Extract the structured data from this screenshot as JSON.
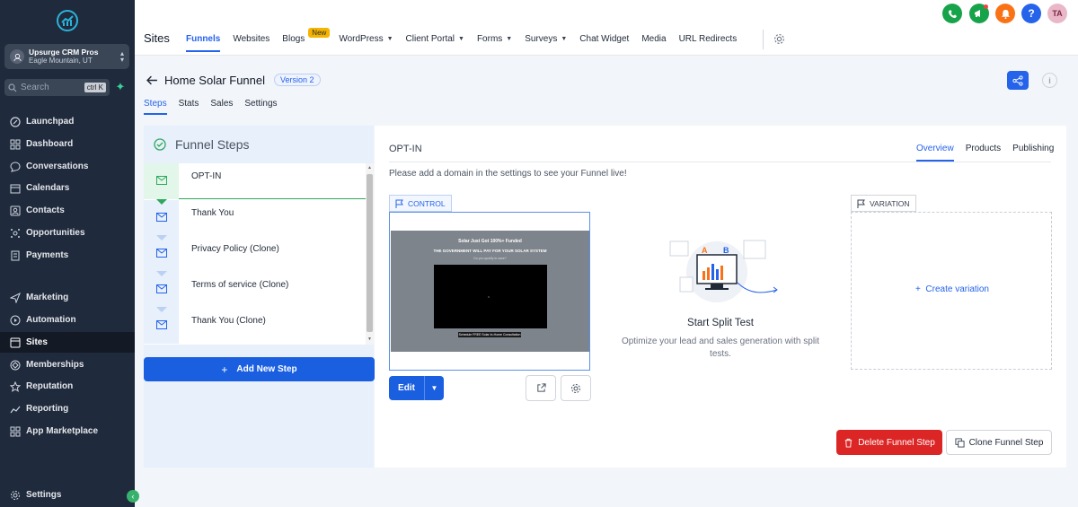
{
  "sidebar": {
    "account": {
      "name": "Upsurge CRM Pros",
      "location": "Eagle Mountain, UT"
    },
    "search": {
      "placeholder": "Search",
      "shortcut": "ctrl K"
    },
    "items": [
      {
        "label": "Launchpad",
        "icon": "rocket-icon"
      },
      {
        "label": "Dashboard",
        "icon": "dashboard-icon"
      },
      {
        "label": "Conversations",
        "icon": "chat-icon"
      },
      {
        "label": "Calendars",
        "icon": "calendar-icon"
      },
      {
        "label": "Contacts",
        "icon": "contacts-icon"
      },
      {
        "label": "Opportunities",
        "icon": "opportunities-icon"
      },
      {
        "label": "Payments",
        "icon": "payments-icon"
      },
      {
        "label": "Marketing",
        "icon": "send-icon"
      },
      {
        "label": "Automation",
        "icon": "automation-icon"
      },
      {
        "label": "Sites",
        "icon": "sites-icon"
      },
      {
        "label": "Memberships",
        "icon": "memberships-icon"
      },
      {
        "label": "Reputation",
        "icon": "star-icon"
      },
      {
        "label": "Reporting",
        "icon": "reporting-icon"
      },
      {
        "label": "App Marketplace",
        "icon": "apps-icon"
      }
    ],
    "active": "Sites",
    "settings_label": "Settings"
  },
  "topbar": {
    "title": "Sites",
    "tabs": [
      {
        "label": "Funnels",
        "active": true
      },
      {
        "label": "Websites"
      },
      {
        "label": "Blogs",
        "badge": "New"
      },
      {
        "label": "WordPress",
        "dropdown": true
      },
      {
        "label": "Client Portal",
        "dropdown": true
      },
      {
        "label": "Forms",
        "dropdown": true
      },
      {
        "label": "Surveys",
        "dropdown": true
      },
      {
        "label": "Chat Widget"
      },
      {
        "label": "Media"
      },
      {
        "label": "URL Redirects"
      }
    ],
    "avatar_initials": "TA",
    "colors": {
      "phone": "#16a34a",
      "announce": "#16a34a",
      "bell": "#f97316",
      "help": "#2563eb"
    }
  },
  "page": {
    "title": "Home Solar Funnel",
    "version": "Version 2",
    "tabs": [
      "Steps",
      "Stats",
      "Sales",
      "Settings"
    ],
    "active_tab": "Steps"
  },
  "funnel_steps": {
    "title": "Funnel Steps",
    "steps": [
      "OPT-IN",
      "Thank You",
      "Privacy Policy (Clone)",
      "Terms of service (Clone)",
      "Thank You (Clone)"
    ],
    "active_step": "OPT-IN",
    "add_label": "Add New Step"
  },
  "step_detail": {
    "title": "OPT-IN",
    "tabs": [
      "Overview",
      "Products",
      "Publishing"
    ],
    "active_tab": "Overview",
    "note": "Please add a domain in the settings to see your Funnel live!",
    "control_label": "CONTROL",
    "variation_label": "VARIATION",
    "preview": {
      "headline": "Solar Just Got 100%+ Funded",
      "subline": "THE GOVERNMENT WILL PAY FOR YOUR SOLAR SYSTEM",
      "small": "Do you qualify to save?",
      "video_mark": "x",
      "cta": "Schedule FREE Solar In-Home Consultation"
    },
    "edit_label": "Edit",
    "split_title": "Start Split Test",
    "split_desc": "Optimize your lead and sales generation with split tests.",
    "create_variation": "Create variation",
    "delete_label": "Delete Funnel Step",
    "clone_label": "Clone Funnel Step",
    "colors": {
      "primary": "#1a5fe0",
      "danger": "#dc2626",
      "success": "#2ea85c"
    }
  }
}
